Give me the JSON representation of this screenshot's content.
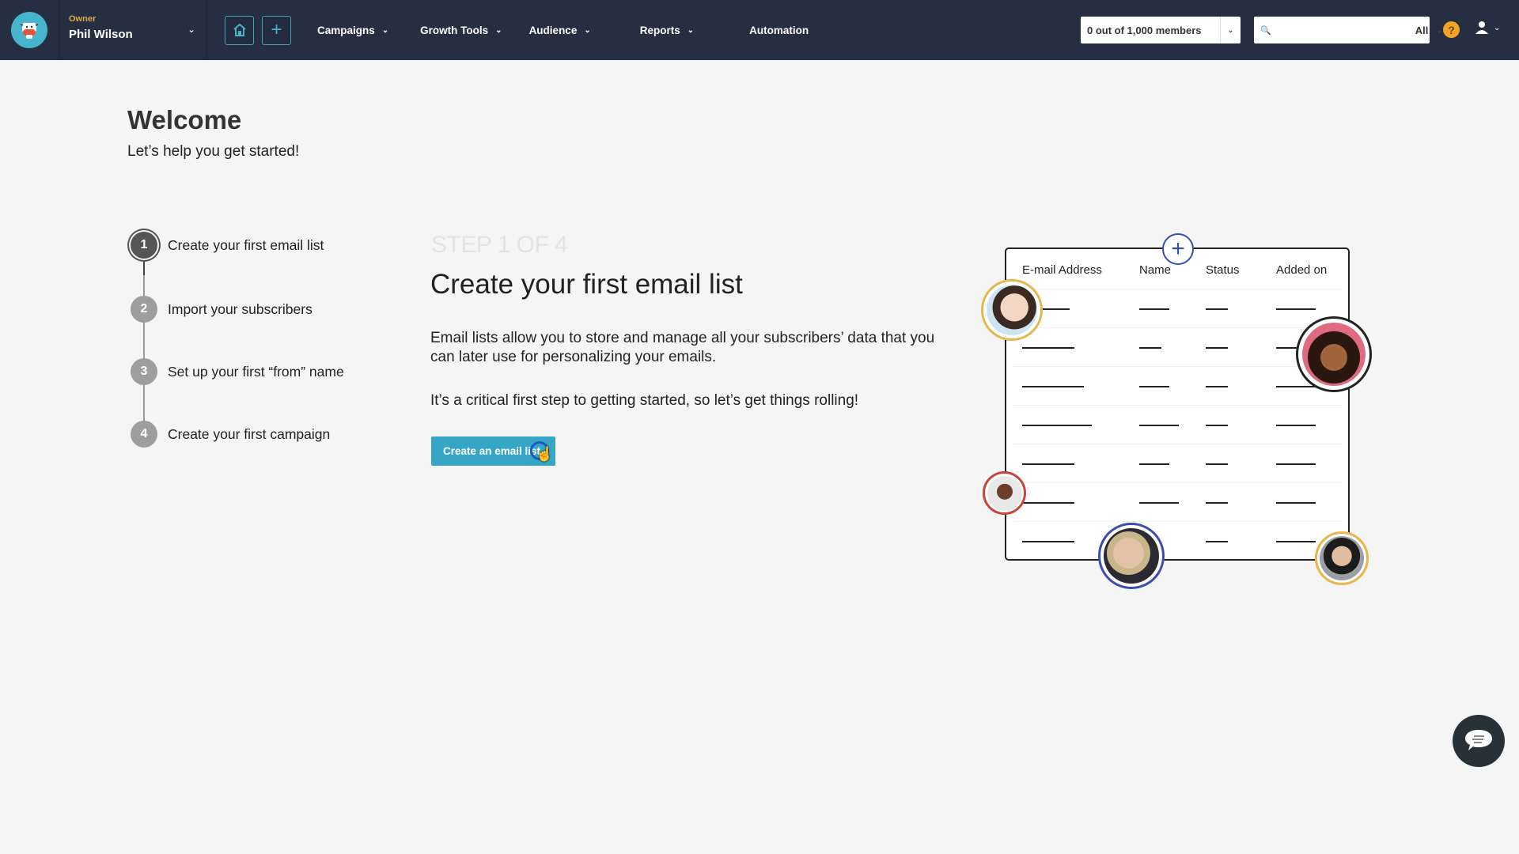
{
  "header": {
    "logo_icon": "cow-mascot-icon",
    "account_role": "Owner",
    "account_name": "Phil Wilson",
    "home_icon": "home-icon",
    "add_icon": "plus-icon",
    "nav": [
      {
        "label": "Campaigns",
        "has_dropdown": true
      },
      {
        "label": "Growth Tools",
        "has_dropdown": true
      },
      {
        "label": "Audience",
        "has_dropdown": true
      },
      {
        "label": "Reports",
        "has_dropdown": true
      },
      {
        "label": "Automation",
        "has_dropdown": false
      }
    ],
    "members_selector": "0 out of 1,000 members",
    "search": {
      "value": "",
      "placeholder": "",
      "scope": "All"
    },
    "help_icon": "help-icon",
    "help_glyph": "?",
    "user_icon": "user-icon"
  },
  "welcome": {
    "title": "Welcome",
    "subtitle": "Let’s help you get started!"
  },
  "steps": [
    {
      "number": "1",
      "label": "Create your first email list",
      "active": true
    },
    {
      "number": "2",
      "label": "Import your subscribers",
      "active": false
    },
    {
      "number": "3",
      "label": "Set up your first “from” name",
      "active": false
    },
    {
      "number": "4",
      "label": "Create your first campaign",
      "active": false
    }
  ],
  "step_content": {
    "counter": "STEP 1 OF 4",
    "title": "Create your first email list",
    "description": "Email lists allow you to store and manage all your subscribers’ data that you can later use for personalizing your emails.",
    "description2": "It’s a critical first step to getting started, so let’s get things rolling!",
    "cta_label": "Create an email list"
  },
  "illustration": {
    "columns": [
      "E-mail Address",
      "Name",
      "Status",
      "Added on"
    ],
    "rows": 7,
    "avatar_ring_colors": [
      "#e8b54a",
      "#222222",
      "#c9453a",
      "#3b4eb0",
      "#e8b54a"
    ]
  },
  "chat_icon": "chat-bubble-icon"
}
